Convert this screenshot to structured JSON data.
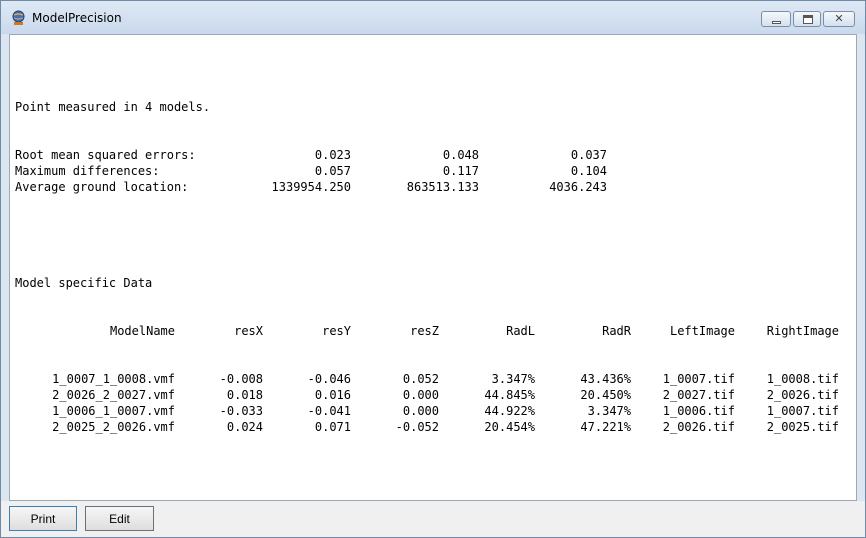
{
  "window": {
    "title": "ModelPrecision",
    "close_glyph": "✕"
  },
  "report": {
    "header_line": "Point measured in 4 models.",
    "summary": [
      {
        "label": "Root mean squared errors:",
        "values": [
          "0.023",
          "0.048",
          "0.037"
        ]
      },
      {
        "label": "Maximum differences:",
        "values": [
          "0.057",
          "0.117",
          "0.104"
        ]
      },
      {
        "label": "Average ground location:",
        "values": [
          "1339954.250",
          "863513.133",
          "4036.243"
        ]
      }
    ],
    "section_title": "Model specific Data",
    "columns": [
      "ModelName",
      "resX",
      "resY",
      "resZ",
      "RadL",
      "RadR",
      "LeftImage",
      "RightImage"
    ],
    "rows": [
      [
        "1_0007_1_0008.vmf",
        "-0.008",
        "-0.046",
        "0.052",
        "3.347%",
        "43.436%",
        "1_0007.tif",
        "1_0008.tif"
      ],
      [
        "2_0026_2_0027.vmf",
        "0.018",
        "0.016",
        "0.000",
        "44.845%",
        "20.450%",
        "2_0027.tif",
        "2_0026.tif"
      ],
      [
        "1_0006_1_0007.vmf",
        "-0.033",
        "-0.041",
        "0.000",
        "44.922%",
        "3.347%",
        "1_0006.tif",
        "1_0007.tif"
      ],
      [
        "2_0025_2_0026.vmf",
        "0.024",
        "0.071",
        "-0.052",
        "20.454%",
        "47.221%",
        "2_0026.tif",
        "2_0025.tif"
      ]
    ]
  },
  "buttons": {
    "print": "Print",
    "edit": "Edit"
  }
}
